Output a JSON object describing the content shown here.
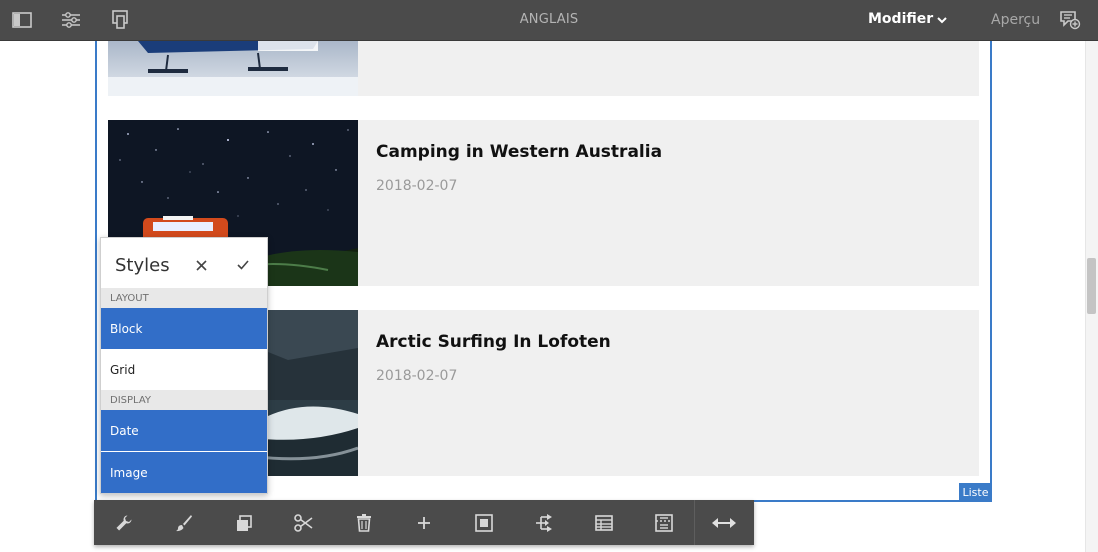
{
  "topbar": {
    "language": "ANGLAIS",
    "mode_label": "Modifier",
    "preview_label": "Aperçu",
    "icons": [
      "side-panel-icon",
      "page-properties-icon",
      "emulator-icon",
      "annotations-icon"
    ]
  },
  "list": {
    "component_label": "Liste",
    "items": [
      {
        "title": "",
        "date": "",
        "image": "seaplane-on-snow"
      },
      {
        "title": "Camping in Western Australia",
        "date": "2018-02-07",
        "image": "camper-van-starry-night"
      },
      {
        "title": "Arctic Surfing In Lofoten",
        "date": "2018-02-07",
        "image": "arctic-waves"
      }
    ]
  },
  "styles_popover": {
    "title": "Styles",
    "close_icon": "close-icon",
    "confirm_icon": "check-icon",
    "groups": [
      {
        "label": "LAYOUT",
        "options": [
          {
            "label": "Block",
            "selected": true
          },
          {
            "label": "Grid",
            "selected": false
          }
        ]
      },
      {
        "label": "DISPLAY",
        "options": [
          {
            "label": "Date",
            "selected": true
          },
          {
            "label": "Image",
            "selected": true
          }
        ]
      }
    ]
  },
  "edit_toolbar": {
    "tools": [
      "configure-icon",
      "styles-brush-icon",
      "copy-icon",
      "cut-icon",
      "delete-icon",
      "insert-icon",
      "select-parent-icon",
      "group-icon",
      "layout-icon",
      "convert-icon",
      "resize-icon"
    ]
  },
  "colors": {
    "topbar_bg": "#4b4b4b",
    "selection_blue": "#326ec8",
    "frame_blue": "#3a7bc8",
    "item_bg": "#f0f0f0"
  }
}
